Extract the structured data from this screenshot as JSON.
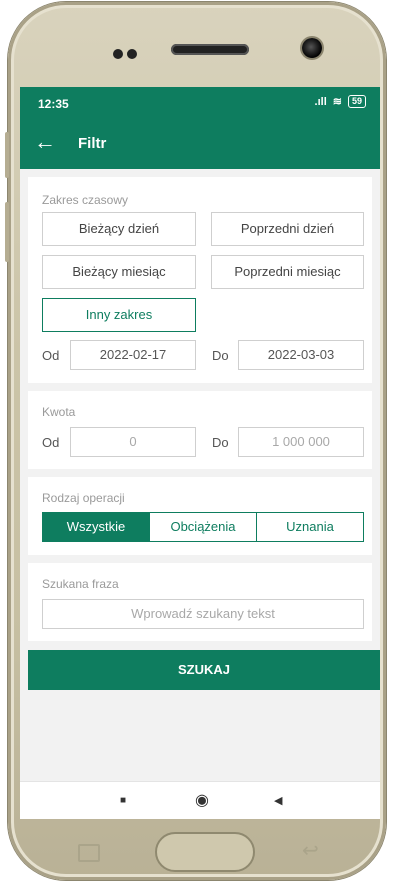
{
  "status": {
    "time": "12:35",
    "signal": ".ıll",
    "wifi": "≋",
    "battery": "59"
  },
  "appbar": {
    "back_icon": "arrow-left-icon",
    "title": "Filtr"
  },
  "time_range": {
    "label": "Zakres czasowy",
    "options": [
      "Bieżący dzień",
      "Poprzedni dzień",
      "Bieżący miesiąc",
      "Poprzedni miesiąc",
      "Inny zakres"
    ],
    "selected": "Inny zakres",
    "from_label": "Od",
    "from_value": "2022-02-17",
    "to_label": "Do",
    "to_value": "2022-03-03"
  },
  "amount": {
    "label": "Kwota",
    "from_label": "Od",
    "from_placeholder": "0",
    "to_label": "Do",
    "to_placeholder": "1 000 000"
  },
  "operation_type": {
    "label": "Rodzaj operacji",
    "options": [
      "Wszystkie",
      "Obciążenia",
      "Uznania"
    ],
    "selected": "Wszystkie"
  },
  "search_phrase": {
    "label": "Szukana fraza",
    "placeholder": "Wprowadź szukany tekst"
  },
  "search_button": {
    "label": "SZUKAJ"
  },
  "navbar": {
    "recent": "■",
    "home": "◉",
    "back": "◀"
  },
  "colors": {
    "brand": "#0e7d5f",
    "background": "#f2f2f2"
  }
}
